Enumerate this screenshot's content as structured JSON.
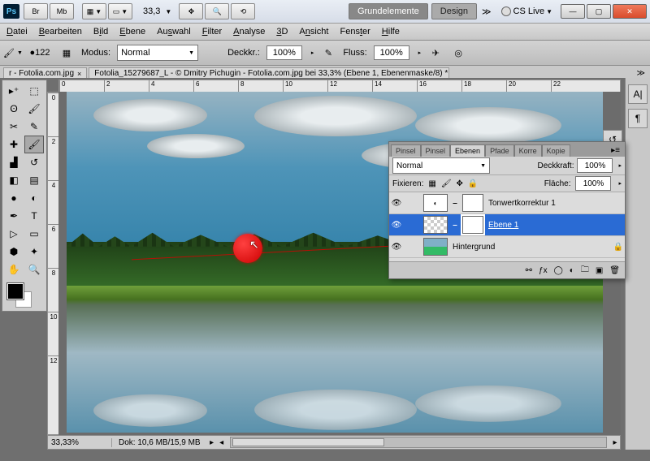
{
  "titlebar": {
    "app_icon": "Ps",
    "br_btn": "Br",
    "mb_btn": "Mb",
    "zoom": "33,3",
    "workspace_active": "Grundelemente",
    "workspace_other": "Design",
    "cslive": "CS Live"
  },
  "menu": {
    "items": [
      "Datei",
      "Bearbeiten",
      "Bild",
      "Ebene",
      "Auswahl",
      "Filter",
      "Analyse",
      "3D",
      "Ansicht",
      "Fenster",
      "Hilfe"
    ]
  },
  "options": {
    "brush_size": "122",
    "mode_label": "Modus:",
    "mode_value": "Normal",
    "opacity_label": "Deckkr.:",
    "opacity_value": "100%",
    "flow_label": "Fluss:",
    "flow_value": "100%"
  },
  "tabs": {
    "t1": "r - Fotolia.com.jpg",
    "t2": "Fotolia_15279687_L - © Dmitry Pichugin - Fotolia.com.jpg bei 33,3% (Ebene 1, Ebenenmaske/8) *"
  },
  "ruler_h": [
    "0",
    "2",
    "4",
    "6",
    "8",
    "10",
    "12",
    "14",
    "16",
    "18",
    "20",
    "22"
  ],
  "ruler_v": [
    "0",
    "2",
    "4",
    "6",
    "8",
    "10",
    "12"
  ],
  "layers_panel": {
    "tabs": [
      "Pinsel",
      "Pinsel",
      "Ebenen",
      "Pfade",
      "Korre",
      "Kopie"
    ],
    "active_tab": 2,
    "blend": "Normal",
    "opacity_label": "Deckkraft:",
    "opacity": "100%",
    "lock_label": "Fixieren:",
    "fill_label": "Fläche:",
    "fill": "100%",
    "rows": [
      {
        "name": "Tonwertkorrektur 1",
        "type": "adj"
      },
      {
        "name": "Ebene 1",
        "type": "layer",
        "selected": true
      },
      {
        "name": "Hintergrund",
        "type": "bg",
        "locked": true
      }
    ]
  },
  "status": {
    "zoom": "33,33%",
    "doc": "Dok: 10,6 MB/15,9 MB"
  }
}
